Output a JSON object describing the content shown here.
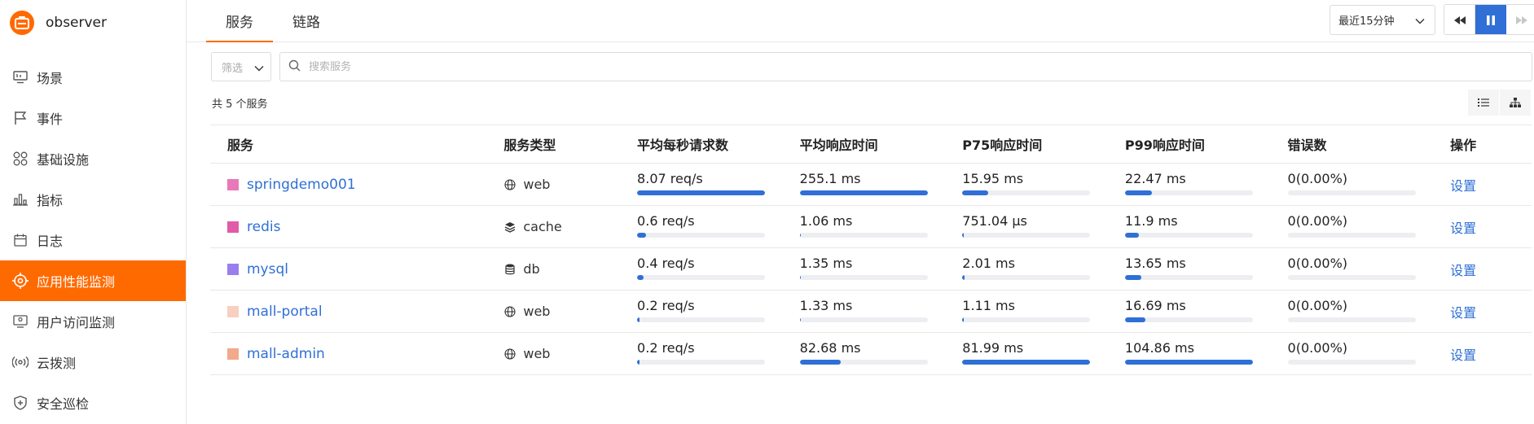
{
  "app": {
    "name": "observer"
  },
  "sidebar": {
    "items": [
      {
        "label": "场景",
        "icon": "monitor-icon",
        "active": false
      },
      {
        "label": "事件",
        "icon": "flag-icon",
        "active": false
      },
      {
        "label": "基础设施",
        "icon": "grid-circles-icon",
        "active": false
      },
      {
        "label": "指标",
        "icon": "bar-chart-icon",
        "active": false
      },
      {
        "label": "日志",
        "icon": "calendar-icon",
        "active": false
      },
      {
        "label": "应用性能监测",
        "icon": "target-icon",
        "active": true
      },
      {
        "label": "用户访问监测",
        "icon": "user-monitor-icon",
        "active": false
      },
      {
        "label": "云拨测",
        "icon": "broadcast-icon",
        "active": false
      },
      {
        "label": "安全巡检",
        "icon": "shield-icon",
        "active": false
      }
    ]
  },
  "tabs": [
    {
      "label": "服务",
      "active": true
    },
    {
      "label": "链路",
      "active": false
    }
  ],
  "time_range": {
    "value": "最近15分钟"
  },
  "filter": {
    "select_label": "筛选",
    "search_placeholder": "搜索服务"
  },
  "summary": "共 5 个服务",
  "table": {
    "columns": [
      "服务",
      "服务类型",
      "平均每秒请求数",
      "平均响应时间",
      "P75响应时间",
      "P99响应时间",
      "错误数",
      "操作"
    ],
    "rows": [
      {
        "name": "springdemo001",
        "color": "#e879b8",
        "type": "web",
        "type_icon": "globe-icon",
        "rps": "8.07 req/s",
        "rps_pct": 100,
        "avg": "255.1 ms",
        "avg_pct": 100,
        "p75": "15.95 ms",
        "p75_pct": 20,
        "p99": "22.47 ms",
        "p99_pct": 21,
        "err": "0(0.00%)",
        "err_pct": 0,
        "op": "设置"
      },
      {
        "name": "redis",
        "color": "#e15ba8",
        "type": "cache",
        "type_icon": "layers-icon",
        "rps": "0.6 req/s",
        "rps_pct": 7,
        "avg": "1.06 ms",
        "avg_pct": 1,
        "p75": "751.04 μs",
        "p75_pct": 1,
        "p99": "11.9 ms",
        "p99_pct": 11,
        "err": "0(0.00%)",
        "err_pct": 0,
        "op": "设置"
      },
      {
        "name": "mysql",
        "color": "#9a7ef0",
        "type": "db",
        "type_icon": "database-icon",
        "rps": "0.4 req/s",
        "rps_pct": 5,
        "avg": "1.35 ms",
        "avg_pct": 1,
        "p75": "2.01 ms",
        "p75_pct": 2,
        "p99": "13.65 ms",
        "p99_pct": 13,
        "err": "0(0.00%)",
        "err_pct": 0,
        "op": "设置"
      },
      {
        "name": "mall-portal",
        "color": "#f8cfc0",
        "type": "web",
        "type_icon": "globe-icon",
        "rps": "0.2 req/s",
        "rps_pct": 2,
        "avg": "1.33 ms",
        "avg_pct": 1,
        "p75": "1.11 ms",
        "p75_pct": 1,
        "p99": "16.69 ms",
        "p99_pct": 16,
        "err": "0(0.00%)",
        "err_pct": 0,
        "op": "设置"
      },
      {
        "name": "mall-admin",
        "color": "#f3a98b",
        "type": "web",
        "type_icon": "globe-icon",
        "rps": "0.2 req/s",
        "rps_pct": 2,
        "avg": "82.68 ms",
        "avg_pct": 32,
        "p75": "81.99 ms",
        "p75_pct": 100,
        "p99": "104.86 ms",
        "p99_pct": 100,
        "err": "0(0.00%)",
        "err_pct": 0,
        "op": "设置"
      }
    ]
  }
}
